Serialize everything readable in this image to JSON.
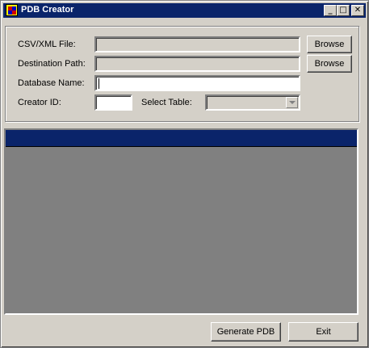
{
  "window": {
    "title": "PDB Creator",
    "controls": {
      "minimize": "_",
      "maximize": "□",
      "close": "✕"
    }
  },
  "form": {
    "csv_label": "CSV/XML File:",
    "csv_value": "",
    "destination_label": "Destination Path:",
    "destination_value": "",
    "database_label": "Database Name:",
    "database_value": "",
    "creator_label": "Creator ID:",
    "creator_value": "",
    "table_label": "Select Table:",
    "table_value": "",
    "browse_csv": "Browse",
    "browse_destination": "Browse"
  },
  "grid": {
    "rows": []
  },
  "footer": {
    "generate_label": "Generate PDB",
    "exit_label": "Exit"
  },
  "colors": {
    "window_bg": "#d4d0c8",
    "titlebar": "#0a246a",
    "grid_header": "#0a246a",
    "grid_bg": "#808080"
  }
}
